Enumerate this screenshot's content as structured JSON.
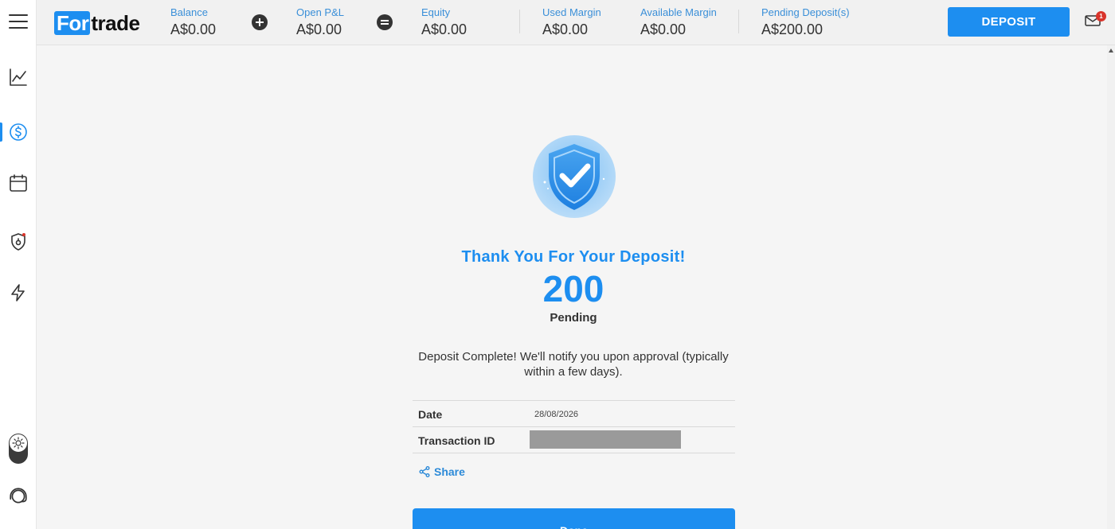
{
  "header": {
    "logo_highlight": "For",
    "logo_rest": "trade",
    "metrics": [
      {
        "label": "Balance",
        "value": "A$0.00"
      },
      {
        "label": "Open P&L",
        "value": "A$0.00"
      },
      {
        "label": "Equity",
        "value": "A$0.00"
      },
      {
        "label": "Used Margin",
        "value": "A$0.00"
      },
      {
        "label": "Available Margin",
        "value": "A$0.00"
      },
      {
        "label": "Pending Deposit(s)",
        "value": "A$200.00"
      }
    ],
    "deposit_label": "DEPOSIT",
    "notification_count": "1"
  },
  "sidebar": {
    "items": [
      {
        "icon": "menu-icon"
      },
      {
        "icon": "chart-line-icon"
      },
      {
        "icon": "dollar-circle-icon",
        "active": true
      },
      {
        "icon": "calendar-icon"
      },
      {
        "icon": "shield-lock-icon"
      },
      {
        "icon": "lightning-icon"
      },
      {
        "icon": "sun-icon"
      },
      {
        "icon": "headset-icon"
      }
    ]
  },
  "confirmation": {
    "title": "Thank You For Your Deposit!",
    "amount": "200",
    "status": "Pending",
    "message": "Deposit Complete! We'll notify you upon approval (typically within a few days).",
    "details": [
      {
        "label": "Date",
        "value": "28/08/2026"
      },
      {
        "label": "Transaction ID",
        "value": ""
      }
    ],
    "share_label": "Share",
    "done_label": "Done"
  },
  "colors": {
    "accent": "#1d8ef0",
    "header_bg": "#f1f1f1",
    "content_bg": "#f5f5f5",
    "badge": "#d9342b"
  }
}
